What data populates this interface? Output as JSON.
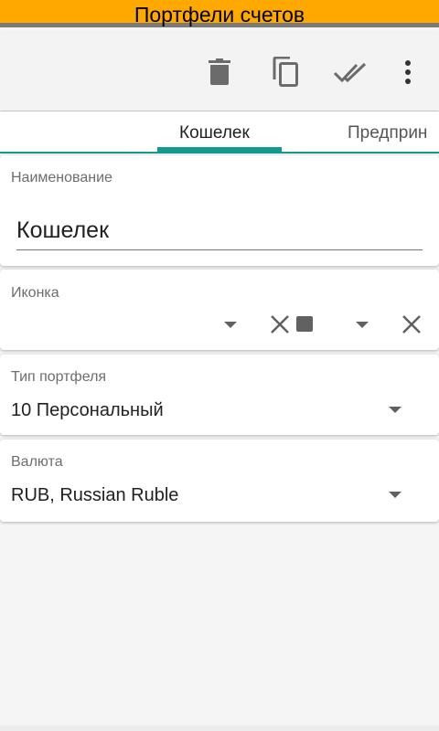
{
  "title_bar": {
    "title": "Портфели счетов",
    "bg_color": "#ffa800"
  },
  "toolbar": {
    "actions": [
      {
        "icon": "trash-icon",
        "label": "delete"
      },
      {
        "icon": "copy-icon",
        "label": "copy"
      },
      {
        "icon": "double-check-icon",
        "label": "done"
      },
      {
        "icon": "more-vert-icon",
        "label": "more"
      }
    ]
  },
  "tabs": [
    {
      "label": "Кошелек",
      "selected": true
    },
    {
      "label": "Предприн",
      "selected": false
    }
  ],
  "accent_color": "#119a8e",
  "form": {
    "name": {
      "label": "Наименование",
      "value": "Кошелек"
    },
    "icon": {
      "label": "Иконка"
    },
    "portfolio_type": {
      "label": "Тип портфеля",
      "value": "10 Персональный"
    },
    "currency": {
      "label": "Валюта",
      "value": "RUB, Russian Ruble"
    }
  }
}
